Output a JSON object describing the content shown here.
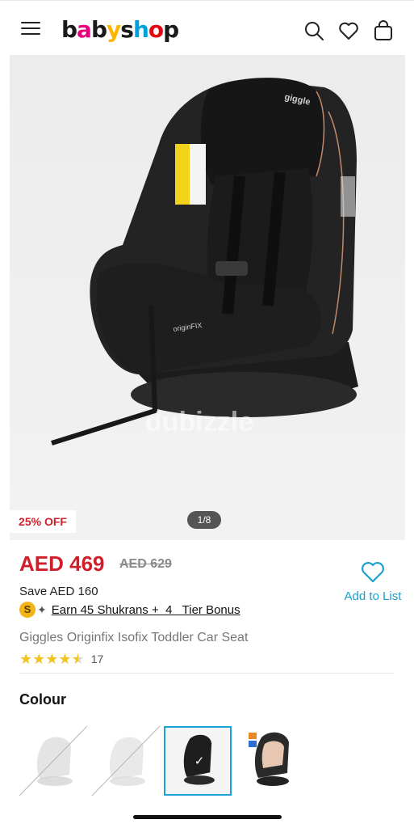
{
  "header": {
    "logo_letters": [
      "b",
      "a",
      "b",
      "y",
      "s",
      "h",
      "o",
      "p"
    ],
    "logo_colors": [
      "#1a1a1a",
      "#e6007e",
      "#1a1a1a",
      "#ffb400",
      "#1a1a1a",
      "#00a0df",
      "#e30613",
      "#1a1a1a"
    ],
    "menu_icon": "hamburger-icon",
    "search_icon": "search-icon",
    "wishlist_icon": "heart-icon",
    "bag_icon": "shopping-bag-icon"
  },
  "gallery": {
    "watermark": "dubizzle",
    "discount_badge": "25% OFF",
    "pager": "1/8",
    "seat_labels": {
      "brand": "giggle",
      "base": "originFIX"
    }
  },
  "pricing": {
    "price": "AED 469",
    "old_price": "AED 629",
    "save": "Save AED 160",
    "shukran_coin": "S",
    "shukran_text": "Earn 45 Shukrans +  4   Tier Bonus"
  },
  "wishlist": {
    "label": "Add to List",
    "icon": "heart-outline-icon"
  },
  "product": {
    "title": "Giggles Originfix Isofix Toddler Car Seat",
    "rating": 4.5,
    "rating_count": "17"
  },
  "colour": {
    "heading": "Colour",
    "swatches": [
      {
        "name": "grey",
        "available": false,
        "selected": false
      },
      {
        "name": "white",
        "available": false,
        "selected": false
      },
      {
        "name": "black",
        "available": true,
        "selected": true
      },
      {
        "name": "beige",
        "available": true,
        "selected": false
      }
    ]
  },
  "colors": {
    "accent_red": "#d01f2b",
    "accent_blue": "#1aa3d8",
    "star_yellow": "#f2c41b"
  }
}
